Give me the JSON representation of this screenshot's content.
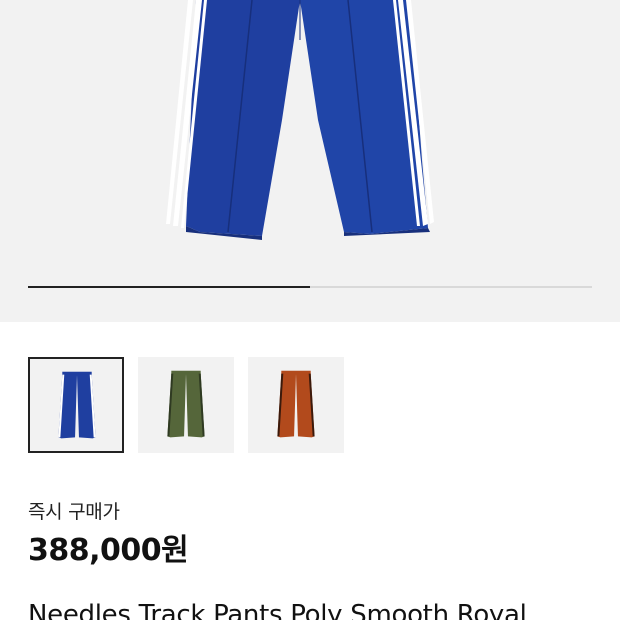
{
  "gallery": {
    "progress_fraction": 0.5,
    "thumbnails": [
      {
        "color": "#1f3fa0",
        "stripe": "#ffffff",
        "selected": true,
        "icon": "royal-blue-pants-thumbnail"
      },
      {
        "color": "#55663a",
        "stripe": "#2f3a22",
        "selected": false,
        "icon": "olive-pants-thumbnail"
      },
      {
        "color": "#b24a1c",
        "stripe": "#3a1a0c",
        "selected": false,
        "icon": "rust-pants-thumbnail"
      }
    ]
  },
  "price": {
    "label": "즉시 구매가",
    "value": "388,000원"
  },
  "product": {
    "name": "Needles Track Pants Poly Smooth Royal"
  }
}
